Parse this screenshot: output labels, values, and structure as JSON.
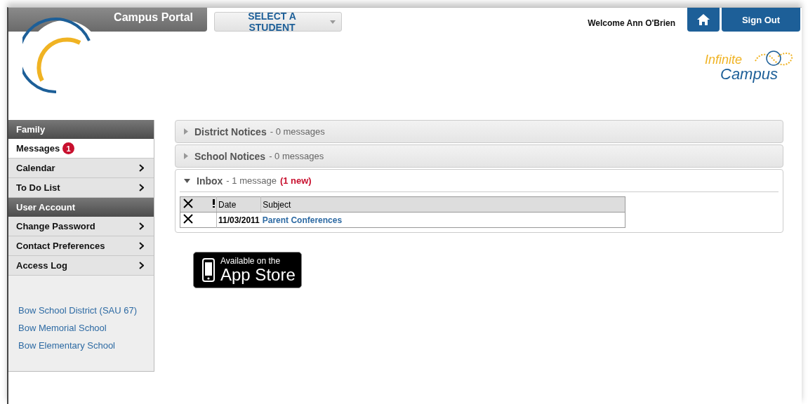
{
  "header": {
    "title": "Campus Portal",
    "student_select": "SELECT A STUDENT",
    "welcome": "Welcome Ann O'Brien",
    "sign_out": "Sign Out",
    "logo": {
      "line1": "Infinite",
      "line2": "Campus"
    }
  },
  "sidebar": {
    "items": [
      {
        "kind": "header",
        "label": "Family"
      },
      {
        "kind": "link",
        "label": "Messages",
        "badge": "1",
        "selected": true
      },
      {
        "kind": "link",
        "label": "Calendar",
        "selected": false
      },
      {
        "kind": "link",
        "label": "To Do List",
        "selected": false
      },
      {
        "kind": "header",
        "label": "User Account"
      },
      {
        "kind": "link",
        "label": "Change Password",
        "selected": false
      },
      {
        "kind": "link",
        "label": "Contact Preferences",
        "selected": false
      },
      {
        "kind": "link",
        "label": "Access Log",
        "selected": false
      }
    ],
    "schools": [
      "Bow School District (SAU 67)",
      "Bow Memorial School",
      "Bow Elementary School"
    ]
  },
  "panels": [
    {
      "title": "District Notices",
      "count": "- 0 messages",
      "expanded": false
    },
    {
      "title": "School Notices",
      "count": "- 0 messages",
      "expanded": false
    },
    {
      "title": "Inbox",
      "count": "- 1 message",
      "new": "(1 new)",
      "expanded": true,
      "table": {
        "columns": [
          "Date",
          "Subject"
        ],
        "rows": [
          {
            "date": "11/03/2011",
            "subject": "Parent Conferences"
          }
        ]
      }
    }
  ],
  "app_store": {
    "line1": "Available on the",
    "line2": "App Store"
  }
}
